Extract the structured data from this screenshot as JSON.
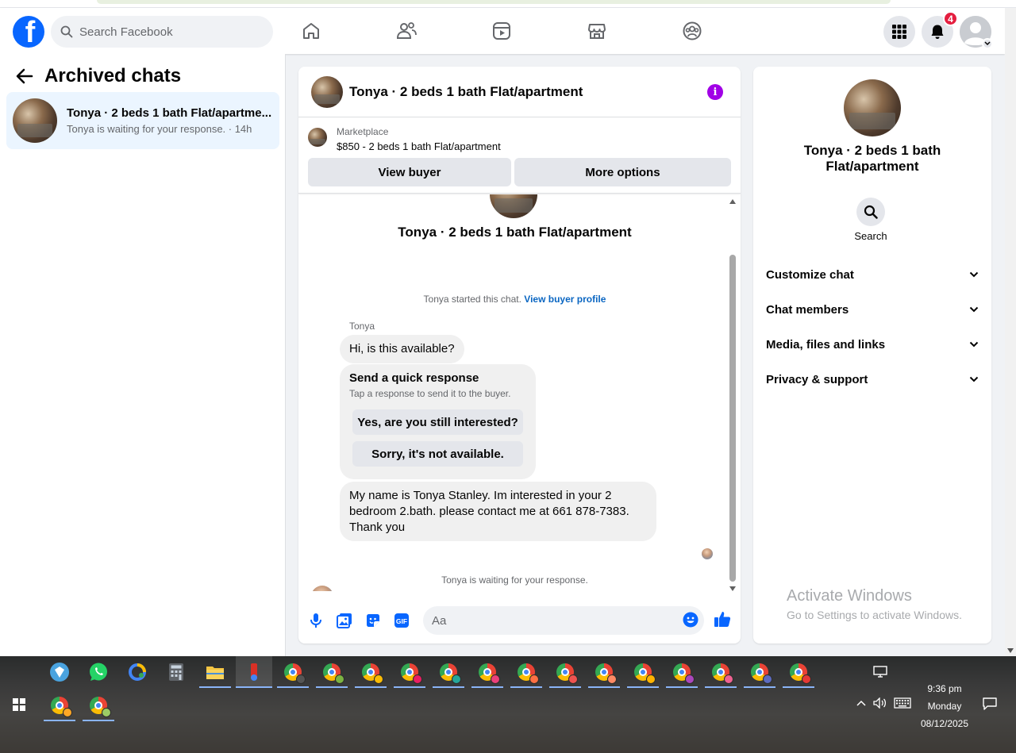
{
  "header": {
    "search_placeholder": "Search Facebook",
    "notification_count": "4",
    "nav_icons": [
      "home-icon",
      "friends-icon",
      "video-icon",
      "marketplace-icon",
      "groups-icon"
    ],
    "brand_color": "#0866ff"
  },
  "sidebar": {
    "title": "Archived chats",
    "chats": [
      {
        "name": "Tonya · 2 beds 1 bath Flat/apartme...",
        "preview": "Tonya is waiting for your response. · 14h"
      }
    ]
  },
  "chat": {
    "title": "Tonya · 2 beds 1 bath Flat/apartment",
    "marketplace_label": "Marketplace",
    "listing": "$850 - 2 beds 1 bath Flat/apartment",
    "view_buyer": "View buyer",
    "more_options": "More options",
    "convo_title": "Tonya · 2 beds 1 bath Flat/apartment",
    "started_text": "Tonya started this chat.",
    "view_profile": "View buyer profile",
    "sender": "Tonya",
    "msg1": "Hi, is this available?",
    "quick_title": "Send a quick response",
    "quick_sub": "Tap a response to send it to the buyer.",
    "quick_yes": "Yes, are you still interested?",
    "quick_no": "Sorry, it's not available.",
    "msg2_line1": "My name is Tonya Stanley. Im interested in your 2",
    "msg2_line2": "bedroom 2.bath. please contact me at 661 878-7383.",
    "msg2_line3": "Thank you",
    "waiting": "Tonya is waiting for your response.",
    "input_placeholder": "Aa"
  },
  "details": {
    "title_line1": "Tonya · 2 beds 1 bath",
    "title_line2": "Flat/apartment",
    "search_label": "Search",
    "sections": [
      "Customize chat",
      "Chat members",
      "Media, files and links",
      "Privacy & support"
    ]
  },
  "watermark": {
    "line1": "Activate Windows",
    "line2": "Go to Settings to activate Windows."
  },
  "taskbar": {
    "time": "9:36 pm",
    "day": "Monday",
    "date": "08/12/2025"
  }
}
